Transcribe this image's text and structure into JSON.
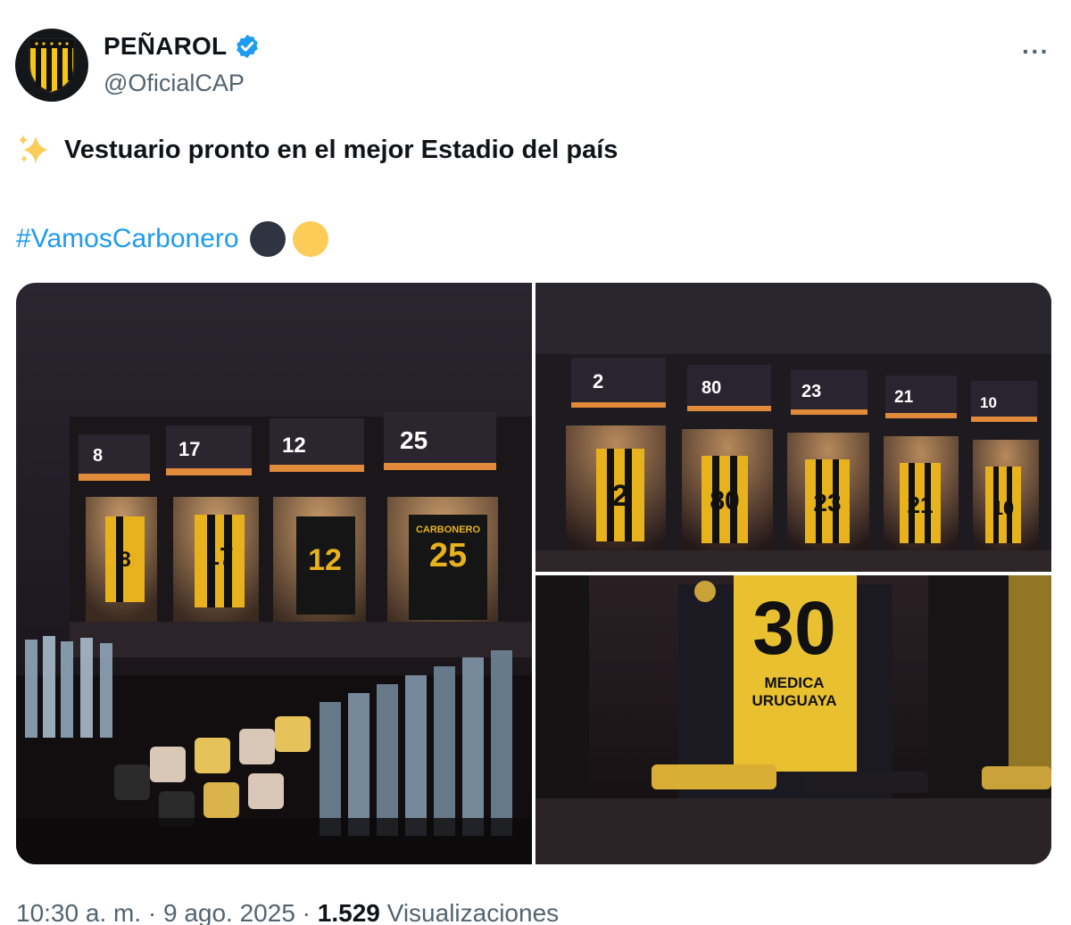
{
  "account": {
    "display_name": "PEÑAROL",
    "handle": "@OficialCAP",
    "verified": true,
    "avatar_icon": "penarol-crest-icon"
  },
  "menu": {
    "more_label": "···"
  },
  "tweet": {
    "emoji_icon": "sparkles-icon",
    "text": "Vestuario pronto en el mejor Estadio del país",
    "hashtag": "#VamosCarbonero",
    "emoji_circles": [
      "black-circle",
      "yellow-circle"
    ]
  },
  "media": {
    "photo1": {
      "numbers": [
        "8",
        "17",
        "12",
        "25"
      ],
      "shirt_name": "CARBONERO"
    },
    "photo2": {
      "numbers": [
        "2",
        "80",
        "23",
        "21",
        "10"
      ]
    },
    "photo3": {
      "number": "30",
      "sponsor_line1": "MEDICA",
      "sponsor_line2": "URUGUAYA"
    }
  },
  "meta": {
    "time": "10:30 a. m.",
    "sep1": " · ",
    "date": "9 ago. 2025",
    "sep2": " · ",
    "views_count": "1.529",
    "views_label": " Visualizaciones"
  },
  "colors": {
    "accent": "#1d9bf0",
    "penarol_yellow": "#f5c518",
    "penarol_black": "#111111"
  }
}
